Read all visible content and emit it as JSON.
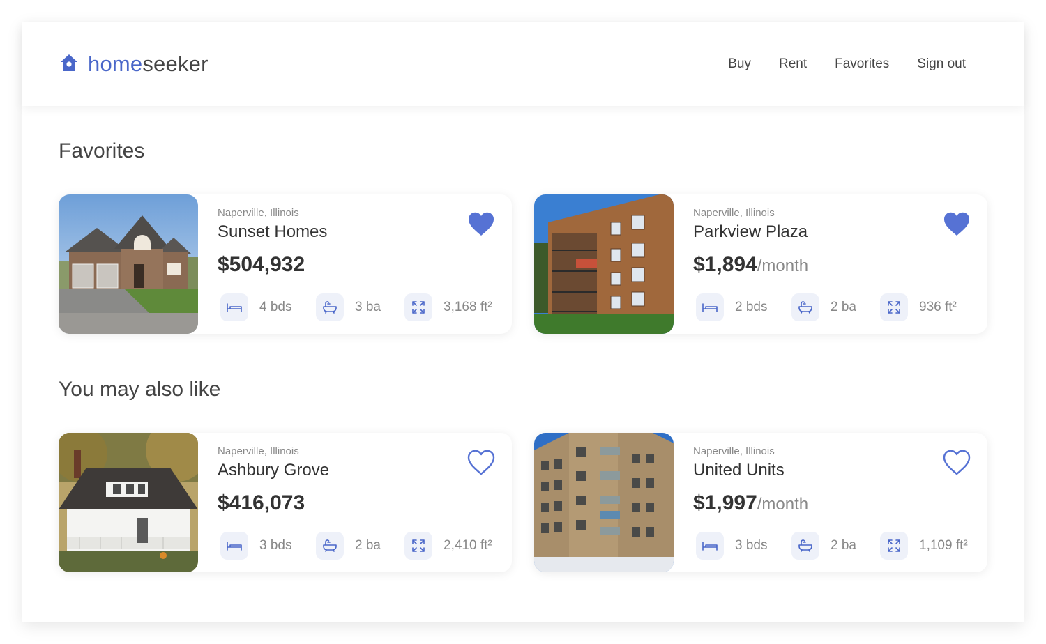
{
  "brand": {
    "name_part1": "home",
    "name_part2": "seeker",
    "accent_color": "#4a67c9",
    "logo_icon": "house-icon"
  },
  "nav": {
    "items": [
      "Buy",
      "Rent",
      "Favorites",
      "Sign out"
    ]
  },
  "sections": {
    "favorites_title": "Favorites",
    "also_like_title": "You may also like"
  },
  "favorites": [
    {
      "location": "Naperville, Illinois",
      "name": "Sunset Homes",
      "price": "$504,932",
      "period": "",
      "beds": "4 bds",
      "baths": "3 ba",
      "area": "3,168 ft²",
      "favorited": true,
      "photo": "brick-house-photo"
    },
    {
      "location": "Naperville, Illinois",
      "name": "Parkview Plaza",
      "price": "$1,894",
      "period": "/month",
      "beds": "2 bds",
      "baths": "2 ba",
      "area": "936 ft²",
      "favorited": true,
      "photo": "apartment-building-photo"
    }
  ],
  "recommended": [
    {
      "location": "Naperville, Illinois",
      "name": "Ashbury Grove",
      "price": "$416,073",
      "period": "",
      "beds": "3 bds",
      "baths": "2 ba",
      "area": "2,410 ft²",
      "favorited": false,
      "photo": "white-house-photo"
    },
    {
      "location": "Naperville, Illinois",
      "name": "United Units",
      "price": "$1,997",
      "period": "/month",
      "beds": "3 bds",
      "baths": "2 ba",
      "area": "1,109 ft²",
      "favorited": false,
      "photo": "apartment-block-photo"
    }
  ],
  "icons": {
    "beds": "bed-icon",
    "baths": "bathtub-icon",
    "area": "expand-icon"
  }
}
